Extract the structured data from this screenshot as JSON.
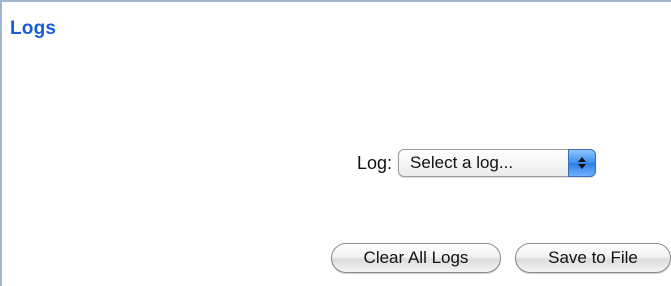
{
  "panel": {
    "title": "Logs"
  },
  "log_selector": {
    "label": "Log:",
    "selected": "Select a log..."
  },
  "buttons": {
    "clear_all": "Clear All Logs",
    "save_to_file": "Save to File"
  },
  "colors": {
    "title": "#1a5bd6",
    "border": "#9fb6cf",
    "stepper": "#3c8ff0"
  }
}
